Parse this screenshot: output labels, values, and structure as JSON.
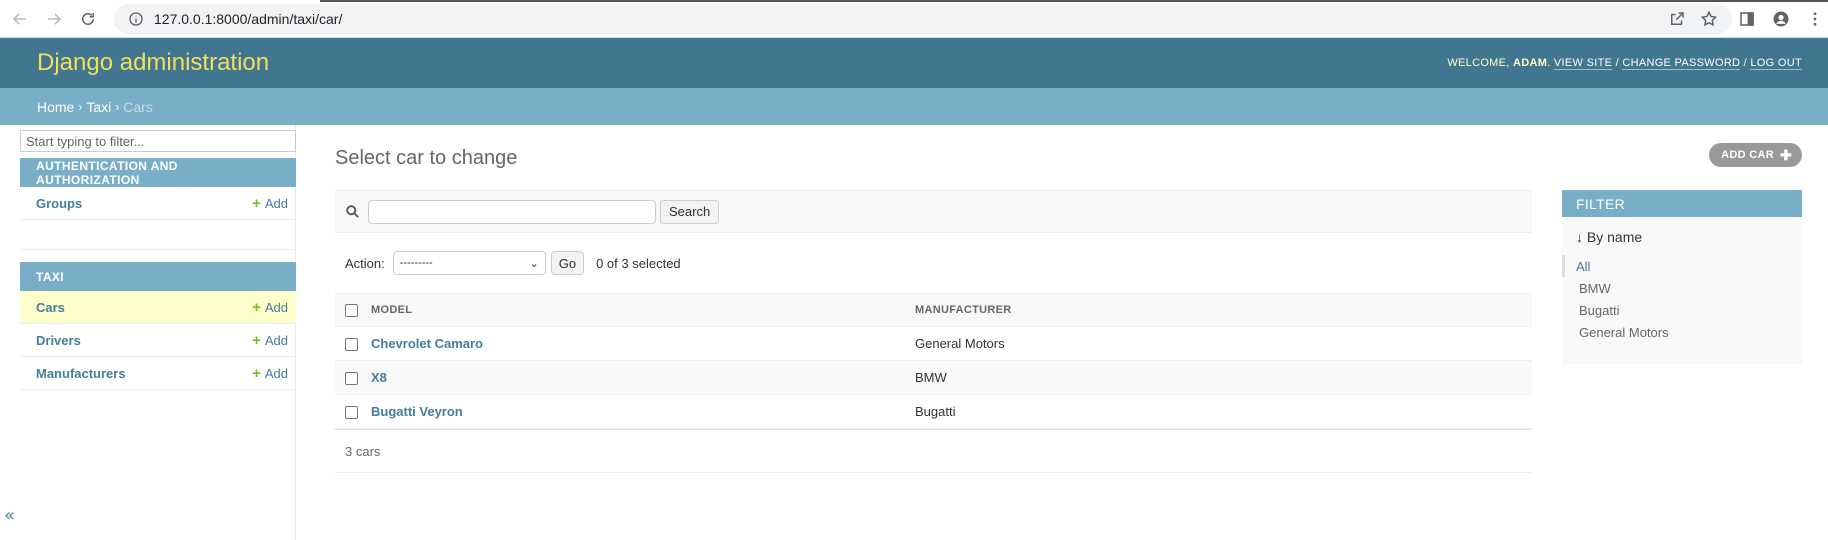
{
  "browser": {
    "url": "127.0.0.1:8000/admin/taxi/car/"
  },
  "header": {
    "branding": "Django administration",
    "welcome": "WELCOME,",
    "username": "ADAM",
    "view_site": "VIEW SITE",
    "change_password": "CHANGE PASSWORD",
    "log_out": "LOG OUT",
    "separator": "/"
  },
  "breadcrumbs": {
    "home": "Home",
    "app": "Taxi",
    "current": "Cars",
    "sep": "›"
  },
  "sidebar": {
    "filter_placeholder": "Start typing to filter...",
    "modules": [
      {
        "caption": "AUTHENTICATION AND AUTHORIZATION",
        "rows": [
          {
            "label": "Groups",
            "add": "Add"
          }
        ]
      },
      {
        "caption": "TAXI",
        "rows": [
          {
            "label": "Cars",
            "add": "Add",
            "current": true
          },
          {
            "label": "Drivers",
            "add": "Add"
          },
          {
            "label": "Manufacturers",
            "add": "Add"
          }
        ]
      }
    ],
    "collapse": "«"
  },
  "content": {
    "title": "Select car to change",
    "add_button": "ADD CAR",
    "search": {
      "button": "Search",
      "value": ""
    },
    "actions": {
      "label": "Action:",
      "selected_option": "---------",
      "go": "Go",
      "selected_count": "0 of 3 selected"
    },
    "table": {
      "columns": [
        "MODEL",
        "MANUFACTURER"
      ],
      "rows": [
        {
          "model": "Chevrolet Camaro",
          "manufacturer": "General Motors"
        },
        {
          "model": "X8",
          "manufacturer": "BMW"
        },
        {
          "model": "Bugatti Veyron",
          "manufacturer": "Bugatti"
        }
      ]
    },
    "paginator": "3 cars"
  },
  "filter": {
    "title": "FILTER",
    "by": "↓ By name",
    "options": [
      {
        "label": "All",
        "selected": true
      },
      {
        "label": "BMW"
      },
      {
        "label": "Bugatti"
      },
      {
        "label": "General Motors"
      }
    ]
  },
  "colors": {
    "header": "#417690",
    "breadcrumbs": "#79aec8",
    "branding": "#f5dd5d",
    "link": "#447e9b",
    "add_plus": "#70bf2b",
    "current_row": "#ffffcc"
  }
}
